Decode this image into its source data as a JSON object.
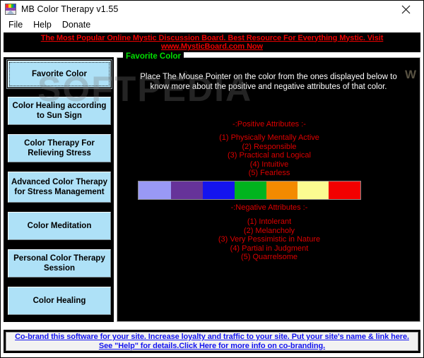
{
  "window": {
    "title": "MB Color Therapy v1.55",
    "icon": "palette-icon",
    "close_label": "✕"
  },
  "menubar": {
    "items": [
      {
        "label": "File"
      },
      {
        "label": "Help"
      },
      {
        "label": "Donate"
      }
    ]
  },
  "top_banner": {
    "text": "The Most Popular Online Mystic Discussion Board. Best Resource For Everything Mystic. Visit www.MysticBoard.com Now",
    "color": "#ee0000"
  },
  "sidebar": {
    "items": [
      {
        "label": "Favorite Color",
        "selected": true
      },
      {
        "label": "Color Healing according to Sun Sign",
        "selected": false
      },
      {
        "label": "Color Therapy For Relieving Stress",
        "selected": false
      },
      {
        "label": "Advanced Color Therapy for Stress Management",
        "selected": false
      },
      {
        "label": "Color Meditation",
        "selected": false
      },
      {
        "label": "Personal Color Therapy Session",
        "selected": false
      },
      {
        "label": "Color Healing",
        "selected": false
      }
    ],
    "button_color": "#aee1f7"
  },
  "main": {
    "group_title": "Favorite Color",
    "group_title_color": "#00e000",
    "instruction": "Place The Mouse Pointer on the color from the ones displayed below to know more about the positive and negative attributes of that color.",
    "positive": {
      "heading": "-:Positive Attributes :-",
      "items": [
        "(1) Physically Mentally Active",
        "(2) Responsible",
        "(3) Practical and Logical",
        "(4) Intuitive",
        "(5) Fearless"
      ]
    },
    "negative": {
      "heading": "-:Negative Attributes :-",
      "items": [
        "(1) Intolerant",
        "(2) Melancholy",
        "(3) Very Pessimistic in Nature",
        "(4) Partial in Judgment",
        "(5) Quarrelsome"
      ]
    },
    "swatches": [
      {
        "name": "periwinkle",
        "color": "#9999f5"
      },
      {
        "name": "purple",
        "color": "#663399"
      },
      {
        "name": "blue",
        "color": "#1414ee"
      },
      {
        "name": "green",
        "color": "#00b41e"
      },
      {
        "name": "orange",
        "color": "#f38a00"
      },
      {
        "name": "light-yellow",
        "color": "#fbfb91"
      },
      {
        "name": "red",
        "color": "#f20000"
      }
    ],
    "text_color": "#dd0000"
  },
  "bottom_banner": {
    "text": "Co-brand this software for your site.  Increase loyalty and traffic to your site. Put your site's name &  link here. See \"Help\" for details.Click Here for more info on co-branding.",
    "color": "#1414ee"
  },
  "watermark": {
    "text": "SOFTPEDIA",
    "degree": "°",
    "mark": "W"
  }
}
